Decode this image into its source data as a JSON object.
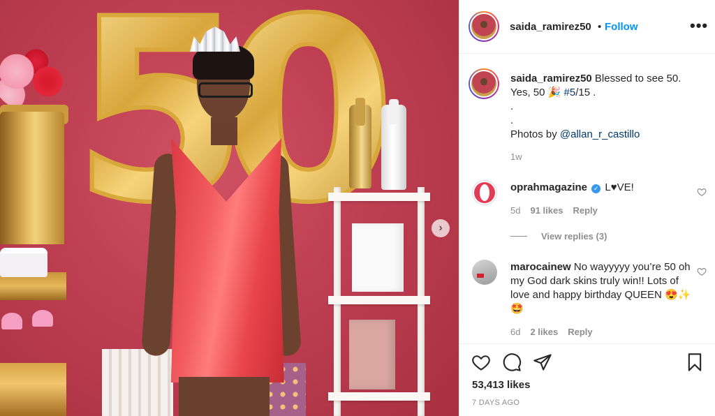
{
  "post": {
    "username": "saida_ramirez50",
    "separator": "•",
    "follow_label": "Follow",
    "more_icon": "more-options-icon",
    "more_glyph": "•••"
  },
  "photo": {
    "balloon_digits": [
      "5",
      "0"
    ],
    "next_icon": "chevron-right-icon",
    "next_glyph": "›"
  },
  "caption": {
    "username": "saida_ramirez50",
    "text_1": "Blessed to see 50.",
    "text_2": "Yes, 50 🎉",
    "hashtag": "#5",
    "text_3": "/15 .",
    "dot_1": ".",
    "dot_2": ".",
    "photos_by": "Photos by",
    "mention": "@allan_r_castillo",
    "time": "1w"
  },
  "comments": [
    {
      "username": "oprahmagazine",
      "verified": true,
      "verified_glyph": "✓",
      "text": "L♥VE!",
      "time": "5d",
      "likes": "91 likes",
      "reply_label": "Reply",
      "view_replies": "View replies (3)"
    },
    {
      "username": "marocainew",
      "text": "No wayyyyy you’re 50 oh my God dark skins truly win!! Lots of love and happy birthday QUEEN 😍✨🤩",
      "time": "6d",
      "likes": "2 likes",
      "reply_label": "Reply"
    }
  ],
  "actions": {
    "likes": "53,413 likes",
    "posted": "7 DAYS AGO"
  },
  "colors": {
    "link_blue": "#0095f6",
    "hashtag_blue": "#00376b",
    "muted": "#8e8e8e",
    "wall_red": "#be3f52"
  }
}
